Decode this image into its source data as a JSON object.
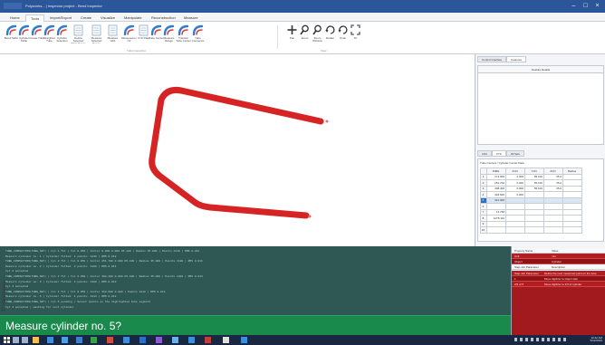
{
  "window": {
    "title": "Polyworks... | Inspector project - Bend Inspector"
  },
  "menu": {
    "tabs": [
      {
        "label": "Home"
      },
      {
        "label": "Tools"
      },
      {
        "label": "Import/Export"
      },
      {
        "label": "Create"
      },
      {
        "label": "Visualize"
      },
      {
        "label": "Manipulate"
      },
      {
        "label": "Reconstruction"
      },
      {
        "label": "Measure"
      }
    ]
  },
  "ribbon": {
    "buttons": [
      {
        "label": "Bend Table",
        "icon": "tube-icon"
      },
      {
        "label": "Cylinder Table",
        "icon": "tube-icon"
      },
      {
        "label": "Create Tube",
        "icon": "tube-icon"
      },
      {
        "label": "Straighten Tube",
        "icon": "tube-icon"
      },
      {
        "label": "Cylinder Selection",
        "icon": "tube-icon"
      },
      {
        "label": "Delete Selected Table Range",
        "icon": "table-icon"
      },
      {
        "label": "Measure Selected Range",
        "icon": "table-icon"
      },
      {
        "label": "Measure LRA",
        "icon": "table-icon"
      },
      {
        "label": "Measurement Ctr",
        "icon": "tube-icon"
      },
      {
        "label": "XYZ Data",
        "icon": "table-icon"
      },
      {
        "label": "Tube Center",
        "icon": "tube-icon"
      },
      {
        "label": "Measure Range",
        "icon": "tube-icon"
      },
      {
        "label": "Transfer Tube Center",
        "icon": "tube-icon"
      },
      {
        "label": "Tube Connector",
        "icon": "tube-icon"
      },
      {
        "label": "Pan",
        "icon": "move-icon"
      },
      {
        "label": "Zoom",
        "icon": "zoom-icon"
      },
      {
        "label": "Zoom Window",
        "icon": "zoom-icon"
      },
      {
        "label": "Rotate",
        "icon": "rotate-icon"
      },
      {
        "label": "Undo",
        "icon": "undo-icon"
      },
      {
        "label": "Fit",
        "icon": "fit-icon"
      }
    ],
    "groups": [
      "Tube Inspection",
      "View"
    ]
  },
  "colors": {
    "tube": "#d62424",
    "console_bg": "#2f5754",
    "prompt_bg": "#198a4c",
    "accent_red": "#b01e21",
    "titlebar": "#2b579a"
  },
  "right_panel": {
    "tabs": [
      "Control Interface",
      "Features"
    ],
    "top_header": "Feature Details",
    "tabs2": [
      "LRA",
      "XYZ",
      "All Sets"
    ],
    "table_caption": "Tube Centers / Cylinder Center Data",
    "columns": [
      "DIME",
      "XCN",
      "YCN",
      "ZCN",
      "Radius"
    ],
    "rows": [
      {
        "n": "1",
        "cells": [
          "174.000",
          "0.000",
          "65.100",
          "35.0"
        ]
      },
      {
        "n": "2",
        "cells": [
          "251.700",
          "0.000",
          "65.100",
          "35.0"
        ]
      },
      {
        "n": "3",
        "cells": [
          "308.400",
          "0.000",
          "65.100",
          "35.0"
        ]
      },
      {
        "n": "4",
        "cells": [
          "318.600",
          "0.000",
          "",
          ""
        ]
      },
      {
        "n": "5",
        "cells": [
          "321.900",
          "",
          "",
          ""
        ]
      },
      {
        "n": "6",
        "cells": [
          "",
          "",
          "",
          ""
        ]
      },
      {
        "n": "7",
        "cells": [
          "14.768",
          "",
          "",
          ""
        ]
      },
      {
        "n": "8",
        "cells": [
          "1278.110",
          "",
          "",
          ""
        ]
      },
      {
        "n": "9",
        "cells": [
          "",
          "",
          "",
          ""
        ]
      },
      {
        "n": "10",
        "cells": [
          "",
          "",
          "",
          ""
        ]
      }
    ]
  },
  "console": {
    "lines": [
      "TUBE_INSPECTION(TUBE_SET) | Cyl 1 fit | Tol 0.050 | Center 0.000 0.000 65.100 | Radius 35.000 | Points 1240 | RMS 0.012",
      "Measure cylinder no. 1 | Cylinder fitted: 1 points: 1240 | RMS 0.012",
      "TUBE_INSPECTION(TUBE_SET) | Cyl 2 fit | Tol 0.050 | Center 251.700 0.000 65.100 | Radius 35.000 | Points 1180 | RMS 0.011",
      "Measure cylinder no. 2 | Cylinder fitted: 2 points: 1180 | RMS 0.011",
      "Cyl 2 accepted",
      "TUBE_INSPECTION(TUBE_SET) | Cyl 3 fit | Tol 0.050 | Center 308.400 0.000 65.100 | Radius 35.000 | Points 1302 | RMS 0.013",
      "Measure cylinder no. 3 | Cylinder fitted: 3 points: 1302 | RMS 0.013",
      "Cyl 3 accepted",
      "TUBE_INSPECTION(TUBE_SET) | Cyl 4 fit | Tol 0.050 | Center 318.600 0.000 | Points 1212 | RMS 0.012",
      "Measure cylinder no. 4 | Cylinder fitted: 4 points: 1212 | RMS 0.012",
      "TUBE_INSPECTION(TUBE_SET) | Cyl 5 pending | Select points on the highlighted tube segment",
      "Cyl 4 accepted | waiting for next cylinder"
    ]
  },
  "prompt": {
    "text": "Measure cylinder no. 5?"
  },
  "properties": {
    "header": {
      "col1": "Property Name",
      "col2": "Value"
    },
    "rows": [
      {
        "name": "Unit",
        "value": "mm"
      },
      {
        "name": "Object",
        "value": "Cylinder"
      }
    ],
    "subheader": {
      "col1": "Step-Job Parameter",
      "col2": "Description"
    },
    "rows2": [
      {
        "name": "Step-Job Parameter",
        "value": "Define the next measured point on the tube"
      },
      {
        "name": "1",
        "value": "Move digitizer to object side"
      },
      {
        "name": "2/3 of 5",
        "value": "Move digitizer to 1/3 of cylinder"
      }
    ]
  },
  "taskbar": {
    "clock_time": "10:42 AM",
    "clock_date": "5/12/2016"
  },
  "watermark": {
    "text": "© Vaishnava"
  }
}
